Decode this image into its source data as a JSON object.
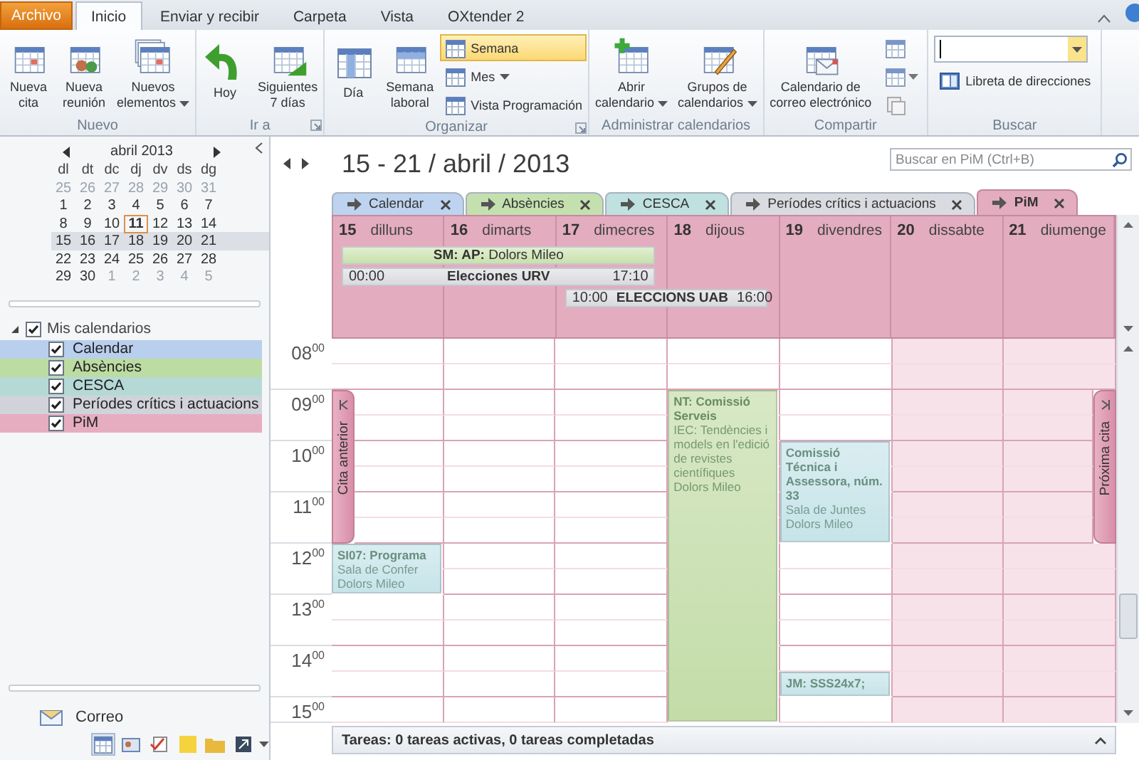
{
  "ribbon_tabs": [
    {
      "label": "Archivo",
      "kind": "backstage",
      "selected": false
    },
    {
      "label": "Inicio",
      "kind": "tab",
      "selected": true
    },
    {
      "label": "Enviar y recibir",
      "kind": "tab",
      "selected": false
    },
    {
      "label": "Carpeta",
      "kind": "tab",
      "selected": false
    },
    {
      "label": "Vista",
      "kind": "tab",
      "selected": false
    },
    {
      "label": "OXtender 2",
      "kind": "tab",
      "selected": false
    }
  ],
  "ribbon_groups": [
    {
      "label": "Nuevo",
      "launcher": false,
      "items": [
        {
          "kind": "large",
          "lines": [
            "Nueva",
            "cita"
          ],
          "menu": false
        },
        {
          "kind": "large",
          "lines": [
            "Nueva",
            "reunión"
          ],
          "menu": false
        },
        {
          "kind": "large",
          "lines": [
            "Nuevos",
            "elementos"
          ],
          "menu": true
        }
      ]
    },
    {
      "label": "Ir a",
      "launcher": true,
      "items": [
        {
          "kind": "large",
          "lines": [
            "Hoy"
          ],
          "menu": false
        },
        {
          "kind": "large",
          "lines": [
            "Siguientes",
            "7 días"
          ],
          "menu": false
        }
      ]
    },
    {
      "label": "Organizar",
      "launcher": true,
      "items": [
        {
          "kind": "large",
          "lines": [
            "Día"
          ],
          "menu": false
        },
        {
          "kind": "large",
          "lines": [
            "Semana",
            "laboral"
          ],
          "menu": false
        },
        {
          "kind": "stack",
          "entries": [
            {
              "label": "Semana",
              "selected": true,
              "menu": false
            },
            {
              "label": "Mes",
              "selected": false,
              "menu": true
            },
            {
              "label": "Vista Programación",
              "selected": false,
              "menu": false
            }
          ]
        }
      ]
    },
    {
      "label": "Administrar calendarios",
      "launcher": false,
      "items": [
        {
          "kind": "large",
          "lines": [
            "Abrir",
            "calendario"
          ],
          "menu": true
        },
        {
          "kind": "large",
          "lines": [
            "Grupos de",
            "calendarios"
          ],
          "menu": true
        }
      ]
    },
    {
      "label": "Compartir",
      "launcher": false,
      "items": [
        {
          "kind": "large",
          "lines": [
            "Calendario de",
            "correo electrónico"
          ],
          "menu": false
        },
        {
          "kind": "icons"
        }
      ]
    },
    {
      "label": "Buscar",
      "launcher": false,
      "items": [
        {
          "kind": "contact_search",
          "link": "Libreta de direcciones"
        }
      ]
    }
  ],
  "mini_calendar": {
    "month": "abril 2013",
    "weekdays": [
      "dl",
      "dt",
      "dc",
      "dj",
      "dv",
      "ds",
      "dg"
    ],
    "weeks": [
      {
        "selected": false,
        "days": [
          {
            "label": "25",
            "other_month": true,
            "today": false
          },
          {
            "label": "26",
            "other_month": true,
            "today": false
          },
          {
            "label": "27",
            "other_month": true,
            "today": false
          },
          {
            "label": "28",
            "other_month": true,
            "today": false
          },
          {
            "label": "29",
            "other_month": true,
            "today": false
          },
          {
            "label": "30",
            "other_month": true,
            "today": false
          },
          {
            "label": "31",
            "other_month": true,
            "today": false
          }
        ]
      },
      {
        "selected": false,
        "days": [
          {
            "label": "1",
            "other_month": false,
            "today": false
          },
          {
            "label": "2",
            "other_month": false,
            "today": false
          },
          {
            "label": "3",
            "other_month": false,
            "today": false
          },
          {
            "label": "4",
            "other_month": false,
            "today": false
          },
          {
            "label": "5",
            "other_month": false,
            "today": false
          },
          {
            "label": "6",
            "other_month": false,
            "today": false
          },
          {
            "label": "7",
            "other_month": false,
            "today": false
          }
        ]
      },
      {
        "selected": false,
        "days": [
          {
            "label": "8",
            "other_month": false,
            "today": false
          },
          {
            "label": "9",
            "other_month": false,
            "today": false
          },
          {
            "label": "10",
            "other_month": false,
            "today": false
          },
          {
            "label": "11",
            "other_month": false,
            "today": true
          },
          {
            "label": "12",
            "other_month": false,
            "today": false
          },
          {
            "label": "13",
            "other_month": false,
            "today": false
          },
          {
            "label": "14",
            "other_month": false,
            "today": false
          }
        ]
      },
      {
        "selected": true,
        "days": [
          {
            "label": "15",
            "other_month": false,
            "today": false
          },
          {
            "label": "16",
            "other_month": false,
            "today": false
          },
          {
            "label": "17",
            "other_month": false,
            "today": false
          },
          {
            "label": "18",
            "other_month": false,
            "today": false
          },
          {
            "label": "19",
            "other_month": false,
            "today": false
          },
          {
            "label": "20",
            "other_month": false,
            "today": false
          },
          {
            "label": "21",
            "other_month": false,
            "today": false
          }
        ]
      },
      {
        "selected": false,
        "days": [
          {
            "label": "22",
            "other_month": false,
            "today": false
          },
          {
            "label": "23",
            "other_month": false,
            "today": false
          },
          {
            "label": "24",
            "other_month": false,
            "today": false
          },
          {
            "label": "25",
            "other_month": false,
            "today": false
          },
          {
            "label": "26",
            "other_month": false,
            "today": false
          },
          {
            "label": "27",
            "other_month": false,
            "today": false
          },
          {
            "label": "28",
            "other_month": false,
            "today": false
          }
        ]
      },
      {
        "selected": false,
        "days": [
          {
            "label": "29",
            "other_month": false,
            "today": false
          },
          {
            "label": "30",
            "other_month": false,
            "today": false
          },
          {
            "label": "1",
            "other_month": true,
            "today": false
          },
          {
            "label": "2",
            "other_month": true,
            "today": false
          },
          {
            "label": "3",
            "other_month": true,
            "today": false
          },
          {
            "label": "4",
            "other_month": true,
            "today": false
          },
          {
            "label": "5",
            "other_month": true,
            "today": false
          }
        ]
      }
    ]
  },
  "folders": {
    "label": "Mis calendarios",
    "expanded": true,
    "checked": true,
    "children": [
      {
        "label": "Calendar",
        "checked": true,
        "color": "#b9cfee"
      },
      {
        "label": "Absències",
        "checked": true,
        "color": "#bcdca2"
      },
      {
        "label": "CESCA",
        "checked": true,
        "color": "#b5d9d7"
      },
      {
        "label": "Períodes crítics i actuacions",
        "checked": true,
        "color": "#d0d3da"
      },
      {
        "label": "PiM",
        "checked": true,
        "color": "#e6adc1"
      }
    ]
  },
  "nav_pane": {
    "label": "Correo"
  },
  "date_range": "15 - 21 / abril / 2013",
  "search": {
    "placeholder": "Buscar en PiM (Ctrl+B)"
  },
  "calendar_tabs": [
    {
      "label": "Calendar",
      "color": "#bdd3ef",
      "selected": false
    },
    {
      "label": "Absències",
      "color": "#c4e0ae",
      "selected": false
    },
    {
      "label": "CESCA",
      "color": "#bfe1e0",
      "selected": false
    },
    {
      "label": "Períodes crítics i actuacions",
      "color": "#d9dbe0",
      "selected": false
    },
    {
      "label": "PiM",
      "color": "#e3acbf",
      "selected": true
    }
  ],
  "days": [
    {
      "number": "15",
      "name": "dilluns",
      "weekend": false
    },
    {
      "number": "16",
      "name": "dimarts",
      "weekend": false
    },
    {
      "number": "17",
      "name": "dimecres",
      "weekend": false
    },
    {
      "number": "18",
      "name": "dijous",
      "weekend": false
    },
    {
      "number": "19",
      "name": "divendres",
      "weekend": false
    },
    {
      "number": "20",
      "name": "dissabte",
      "weekend": true
    },
    {
      "number": "21",
      "name": "diumenge",
      "weekend": true
    }
  ],
  "banner_rows": [
    {
      "slots": [
        {
          "kind": "all_day",
          "title": "**SM: AP:** Dolors Mileo",
          "color": "#c8e1ab"
        },
        {
          "kind": "continuation"
        },
        {
          "kind": "continuation"
        },
        {
          "kind": "empty"
        },
        {
          "kind": "empty"
        },
        {
          "kind": "empty"
        },
        {
          "kind": "empty"
        }
      ]
    },
    {
      "slots": [
        {
          "kind": "timed",
          "start_time": "00:00",
          "title": "Elecciones URV",
          "end_time": "17:10",
          "color": "#d9dade"
        },
        {
          "kind": "continuation"
        },
        {
          "kind": "continuation"
        },
        {
          "kind": "empty"
        },
        {
          "kind": "empty"
        },
        {
          "kind": "empty"
        },
        {
          "kind": "empty"
        }
      ]
    },
    {
      "slots": [
        {
          "kind": "empty"
        },
        {
          "kind": "empty"
        },
        {
          "kind": "timed",
          "start_time": "10:00",
          "title": "ELECCIONS UAB",
          "end_time": "16:00",
          "color": "#d9dade"
        },
        {
          "kind": "continuation"
        },
        {
          "kind": "empty"
        },
        {
          "kind": "empty"
        },
        {
          "kind": "empty"
        }
      ]
    }
  ],
  "time_rows": [
    {
      "hour": "08$^{00}$",
      "cells": [
        {
          "kind": "free"
        },
        {
          "kind": "free"
        },
        {
          "kind": "free"
        },
        {
          "kind": "free"
        },
        {
          "kind": "free"
        },
        {
          "kind": "free"
        },
        {
          "kind": "free"
        }
      ]
    },
    {
      "cells": [
        {
          "kind": "free"
        },
        {
          "kind": "free"
        },
        {
          "kind": "free"
        },
        {
          "kind": "free"
        },
        {
          "kind": "free"
        },
        {
          "kind": "free"
        },
        {
          "kind": "free"
        }
      ]
    },
    {
      "hour": "09$^{00}$",
      "cells": [
        {
          "kind": "free"
        },
        {
          "kind": "free"
        },
        {
          "kind": "free"
        },
        {
          "kind": "appointment",
          "title": "NT: Comissió Serveis",
          "lines": [
            "IEC: Tendències i models en l'edició de revistes científiques",
            "Dolors Mileo"
          ],
          "color": "#c3dca8"
        },
        {
          "kind": "free"
        },
        {
          "kind": "free"
        },
        {
          "kind": "free"
        }
      ]
    },
    {
      "cells": [
        {
          "kind": "free"
        },
        {
          "kind": "free"
        },
        {
          "kind": "free"
        },
        {
          "kind": "covered"
        },
        {
          "kind": "free"
        },
        {
          "kind": "free"
        },
        {
          "kind": "free"
        }
      ]
    },
    {
      "hour": "10$^{00}$",
      "cells": [
        {
          "kind": "free"
        },
        {
          "kind": "free"
        },
        {
          "kind": "free"
        },
        {
          "kind": "covered"
        },
        {
          "kind": "appointment",
          "title": "Comissió Técnica i Assessora, núm. 33",
          "lines": [
            "Sala de Juntes",
            "Dolors Mileo"
          ],
          "color": "#c6e4e9"
        },
        {
          "kind": "free"
        },
        {
          "kind": "free"
        }
      ]
    },
    {
      "cells": [
        {
          "kind": "free"
        },
        {
          "kind": "free"
        },
        {
          "kind": "free"
        },
        {
          "kind": "covered"
        },
        {
          "kind": "covered"
        },
        {
          "kind": "free"
        },
        {
          "kind": "free"
        }
      ]
    },
    {
      "hour": "11$^{00}$",
      "cells": [
        {
          "kind": "free"
        },
        {
          "kind": "free"
        },
        {
          "kind": "free"
        },
        {
          "kind": "covered"
        },
        {
          "kind": "covered"
        },
        {
          "kind": "free"
        },
        {
          "kind": "free"
        }
      ]
    },
    {
      "cells": [
        {
          "kind": "free"
        },
        {
          "kind": "free"
        },
        {
          "kind": "free"
        },
        {
          "kind": "covered"
        },
        {
          "kind": "covered"
        },
        {
          "kind": "free"
        },
        {
          "kind": "free"
        }
      ]
    },
    {
      "hour": "12$^{00}$",
      "cells": [
        {
          "kind": "appointment",
          "title": "SI07: Programa",
          "lines": [
            "Sala de Confer",
            "Dolors Mileo"
          ],
          "color": "#c6e4e9"
        },
        {
          "kind": "free"
        },
        {
          "kind": "free"
        },
        {
          "kind": "covered"
        },
        {
          "kind": "free"
        },
        {
          "kind": "free"
        },
        {
          "kind": "free"
        }
      ]
    },
    {
      "cells": [
        {
          "kind": "covered"
        },
        {
          "kind": "free"
        },
        {
          "kind": "free"
        },
        {
          "kind": "covered"
        },
        {
          "kind": "free"
        },
        {
          "kind": "free"
        },
        {
          "kind": "free"
        }
      ]
    },
    {
      "hour": "13$^{00}$",
      "cells": [
        {
          "kind": "free"
        },
        {
          "kind": "free"
        },
        {
          "kind": "free"
        },
        {
          "kind": "covered"
        },
        {
          "kind": "free"
        },
        {
          "kind": "free"
        },
        {
          "kind": "free"
        }
      ]
    },
    {
      "cells": [
        {
          "kind": "free"
        },
        {
          "kind": "free"
        },
        {
          "kind": "free"
        },
        {
          "kind": "covered"
        },
        {
          "kind": "free"
        },
        {
          "kind": "free"
        },
        {
          "kind": "free"
        }
      ]
    },
    {
      "hour": "14$^{00}$",
      "cells": [
        {
          "kind": "free"
        },
        {
          "kind": "free"
        },
        {
          "kind": "free"
        },
        {
          "kind": "covered"
        },
        {
          "kind": "free"
        },
        {
          "kind": "free"
        },
        {
          "kind": "free"
        }
      ]
    },
    {
      "cells": [
        {
          "kind": "free"
        },
        {
          "kind": "free"
        },
        {
          "kind": "free"
        },
        {
          "kind": "covered"
        },
        {
          "kind": "appointment",
          "title": "JM: SSS24x7;",
          "color": "#c6e4e9"
        },
        {
          "kind": "free"
        },
        {
          "kind": "free"
        }
      ]
    },
    {
      "hour": "15$^{00}$",
      "cells": [
        {
          "kind": "free"
        },
        {
          "kind": "free"
        },
        {
          "kind": "free"
        },
        {
          "kind": "covered"
        },
        {
          "kind": "free"
        },
        {
          "kind": "free"
        },
        {
          "kind": "free"
        }
      ]
    }
  ],
  "previous_appointment": {
    "label": "Cita anterior"
  },
  "next_appointment": {
    "label": "Próxima cita"
  },
  "tasks_bar": {
    "text": "Tareas: 0 tareas activas, 0 tareas completadas"
  }
}
